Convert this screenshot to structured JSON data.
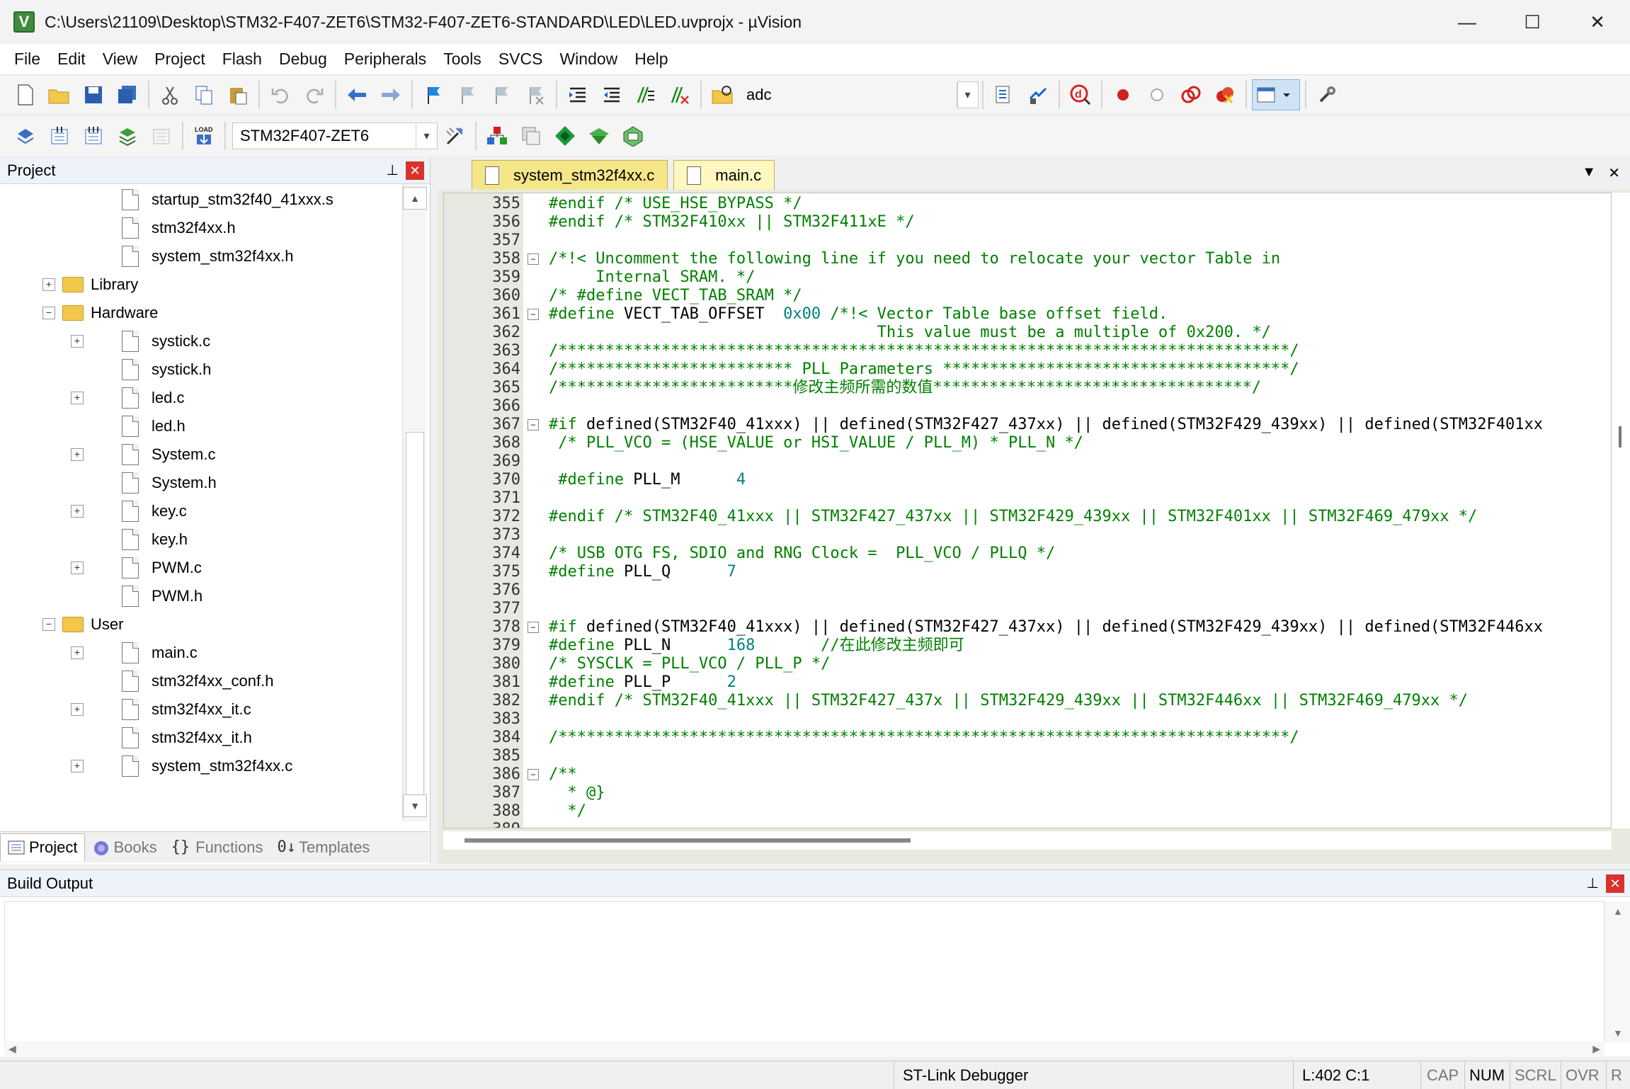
{
  "window": {
    "title": "C:\\Users\\21109\\Desktop\\STM32-F407-ZET6\\STM32-F407-ZET6-STANDARD\\LED\\LED.uvprojx - µVision",
    "app_icon_letter": "V",
    "minimize": "—",
    "maximize": "☐",
    "close": "✕"
  },
  "menu": [
    "File",
    "Edit",
    "View",
    "Project",
    "Flash",
    "Debug",
    "Peripherals",
    "Tools",
    "SVCS",
    "Window",
    "Help"
  ],
  "toolbar1": {
    "find_value": "adc"
  },
  "toolbar2": {
    "target_value": "STM32F407-ZET6"
  },
  "project_panel": {
    "title": "Project",
    "pin": "⊥",
    "close": "✕",
    "tree": [
      {
        "label": "startup_stm32f40_41xxx.s",
        "kind": "file",
        "level": 2,
        "expander": ""
      },
      {
        "label": "stm32f4xx.h",
        "kind": "file",
        "level": 2,
        "expander": ""
      },
      {
        "label": "system_stm32f4xx.h",
        "kind": "file",
        "level": 2,
        "expander": ""
      },
      {
        "label": "Library",
        "kind": "folder",
        "level": 1,
        "expander": "+"
      },
      {
        "label": "Hardware",
        "kind": "folder",
        "level": 1,
        "expander": "−"
      },
      {
        "label": "systick.c",
        "kind": "file",
        "level": 2,
        "expander": "+"
      },
      {
        "label": "systick.h",
        "kind": "file",
        "level": 2,
        "expander": ""
      },
      {
        "label": "led.c",
        "kind": "file",
        "level": 2,
        "expander": "+"
      },
      {
        "label": "led.h",
        "kind": "file",
        "level": 2,
        "expander": ""
      },
      {
        "label": "System.c",
        "kind": "file",
        "level": 2,
        "expander": "+"
      },
      {
        "label": "System.h",
        "kind": "file",
        "level": 2,
        "expander": ""
      },
      {
        "label": "key.c",
        "kind": "file",
        "level": 2,
        "expander": "+"
      },
      {
        "label": "key.h",
        "kind": "file",
        "level": 2,
        "expander": ""
      },
      {
        "label": "PWM.c",
        "kind": "file",
        "level": 2,
        "expander": "+"
      },
      {
        "label": "PWM.h",
        "kind": "file",
        "level": 2,
        "expander": ""
      },
      {
        "label": "User",
        "kind": "folder",
        "level": 1,
        "expander": "−"
      },
      {
        "label": "main.c",
        "kind": "file",
        "level": 2,
        "expander": "+"
      },
      {
        "label": "stm32f4xx_conf.h",
        "kind": "file",
        "level": 2,
        "expander": ""
      },
      {
        "label": "stm32f4xx_it.c",
        "kind": "file",
        "level": 2,
        "expander": "+"
      },
      {
        "label": "stm32f4xx_it.h",
        "kind": "file",
        "level": 2,
        "expander": ""
      },
      {
        "label": "system_stm32f4xx.c",
        "kind": "file",
        "level": 2,
        "expander": "+"
      }
    ],
    "tabs": [
      "Project",
      "Books",
      "Functions",
      "Templates"
    ]
  },
  "editor": {
    "tabs": [
      {
        "label": "system_stm32f4xx.c",
        "active": true
      },
      {
        "label": "main.c",
        "active": false
      }
    ],
    "tab_menu": "▼",
    "tab_close": "✕",
    "lines": [
      {
        "n": "355",
        "fold": "",
        "text": "#endif /* USE_HSE_BYPASS */",
        "style": "green"
      },
      {
        "n": "356",
        "fold": "",
        "text": "#endif /* STM32F410xx || STM32F411xE */",
        "style": "green"
      },
      {
        "n": "357",
        "fold": "",
        "text": "",
        "style": "plain"
      },
      {
        "n": "358",
        "fold": "−",
        "text": "/*!< Uncomment the following line if you need to relocate your vector Table in",
        "style": "green"
      },
      {
        "n": "359",
        "fold": "",
        "text": "     Internal SRAM. */",
        "style": "green"
      },
      {
        "n": "360",
        "fold": "",
        "text": "/* #define VECT_TAB_SRAM */",
        "style": "green"
      },
      {
        "n": "361",
        "fold": "−",
        "text": "#define VECT_TAB_OFFSET  0x00 /*!< Vector Table base offset field.",
        "style": "define"
      },
      {
        "n": "362",
        "fold": "",
        "text": "                                   This value must be a multiple of 0x200. */",
        "style": "green"
      },
      {
        "n": "363",
        "fold": "",
        "text": "/******************************************************************************/",
        "style": "green"
      },
      {
        "n": "364",
        "fold": "",
        "text": "/************************* PLL Parameters *************************************/",
        "style": "green"
      },
      {
        "n": "365",
        "fold": "",
        "text": "/*************************修改主频所需的数值**********************************/",
        "style": "green"
      },
      {
        "n": "366",
        "fold": "",
        "text": "",
        "style": "plain"
      },
      {
        "n": "367",
        "fold": "−",
        "text": "#if defined(STM32F40_41xxx) || defined(STM32F427_437xx) || defined(STM32F429_439xx) || defined(STM32F401xx",
        "style": "if"
      },
      {
        "n": "368",
        "fold": "",
        "text": " /* PLL_VCO = (HSE_VALUE or HSI_VALUE / PLL_M) * PLL_N */",
        "style": "green"
      },
      {
        "n": "369",
        "fold": "",
        "text": "",
        "style": "plain"
      },
      {
        "n": "370",
        "fold": "",
        "text": " #define PLL_M      4",
        "style": "define"
      },
      {
        "n": "371",
        "fold": "",
        "text": "",
        "style": "plain"
      },
      {
        "n": "372",
        "fold": "",
        "text": "#endif /* STM32F40_41xxx || STM32F427_437xx || STM32F429_439xx || STM32F401xx || STM32F469_479xx */",
        "style": "green"
      },
      {
        "n": "373",
        "fold": "",
        "text": "",
        "style": "plain"
      },
      {
        "n": "374",
        "fold": "",
        "text": "/* USB OTG FS, SDIO and RNG Clock =  PLL_VCO / PLLQ */",
        "style": "green"
      },
      {
        "n": "375",
        "fold": "",
        "text": "#define PLL_Q      7",
        "style": "define"
      },
      {
        "n": "376",
        "fold": "",
        "text": "",
        "style": "plain"
      },
      {
        "n": "377",
        "fold": "",
        "text": "",
        "style": "plain"
      },
      {
        "n": "378",
        "fold": "−",
        "text": "#if defined(STM32F40_41xxx) || defined(STM32F427_437xx) || defined(STM32F429_439xx) || defined(STM32F446xx",
        "style": "if"
      },
      {
        "n": "379",
        "fold": "",
        "text": "#define PLL_N      168       //在此修改主频即可",
        "style": "define"
      },
      {
        "n": "380",
        "fold": "",
        "text": "/* SYSCLK = PLL_VCO / PLL_P */",
        "style": "green"
      },
      {
        "n": "381",
        "fold": "",
        "text": "#define PLL_P      2",
        "style": "define"
      },
      {
        "n": "382",
        "fold": "",
        "text": "#endif /* STM32F40_41xxx || STM32F427_437x || STM32F429_439xx || STM32F446xx || STM32F469_479xx */",
        "style": "green"
      },
      {
        "n": "383",
        "fold": "",
        "text": "",
        "style": "plain"
      },
      {
        "n": "384",
        "fold": "",
        "text": "/******************************************************************************/",
        "style": "green"
      },
      {
        "n": "385",
        "fold": "",
        "text": "",
        "style": "plain"
      },
      {
        "n": "386",
        "fold": "−",
        "text": "/**",
        "style": "green"
      },
      {
        "n": "387",
        "fold": "",
        "text": "  * @}",
        "style": "green"
      },
      {
        "n": "388",
        "fold": "",
        "text": "  */",
        "style": "green"
      },
      {
        "n": "389",
        "fold": "",
        "text": "",
        "style": "plain"
      }
    ]
  },
  "build_output": {
    "title": "Build Output",
    "pin": "⊥",
    "close": "✕"
  },
  "statusbar": {
    "debugger": "ST-Link Debugger",
    "position": "L:402 C:1",
    "cap": "CAP",
    "num": "NUM",
    "scrl": "SCRL",
    "ovr": "OVR",
    "rw": "R"
  }
}
